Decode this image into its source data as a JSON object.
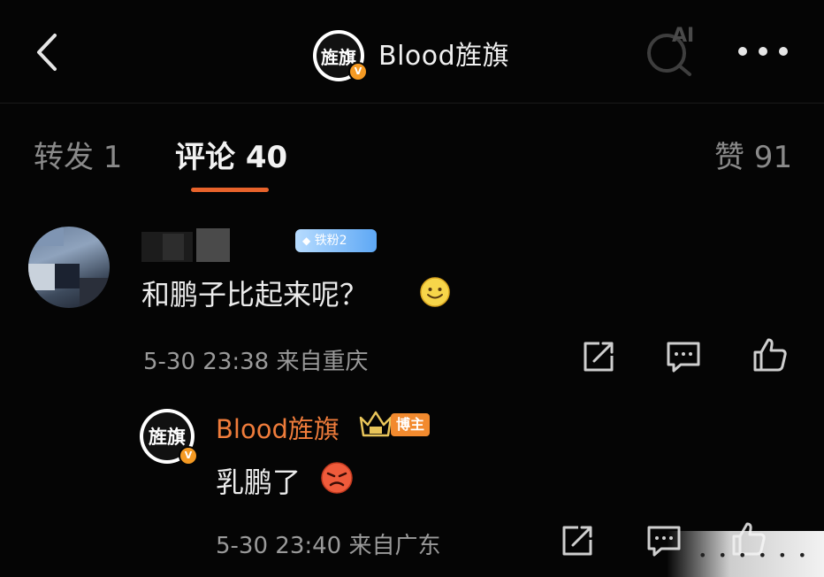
{
  "header": {
    "title": "Blood旌旗",
    "avatar_logo": "旌旗",
    "verified_mark": "V",
    "icons": {
      "back": "chevron-left-icon",
      "ai_search": "ai-search-icon",
      "more": "more-dots-icon"
    },
    "ai_label": "AI"
  },
  "tabs": {
    "repost": "转发 1",
    "comments": "评论 40",
    "likes": "赞 91"
  },
  "comment": {
    "fan_badge": "铁粉2",
    "text": "和鹏子比起来呢？",
    "emoji": "smile-emoji",
    "time_location": "5-30 23:38  来自重庆"
  },
  "reply": {
    "author": "Blood旌旗",
    "author_badge": "博主",
    "avatar_logo": "旌旗",
    "verified_mark": "V",
    "text": "乳鹏了",
    "emoji": "angry-emoji",
    "time_location": "5-30 23:40  来自广东"
  },
  "colors": {
    "background": "#050505",
    "accent": "#e8632b",
    "author_name": "#ef7c3b",
    "fan_badge": "#5ea8f5"
  }
}
